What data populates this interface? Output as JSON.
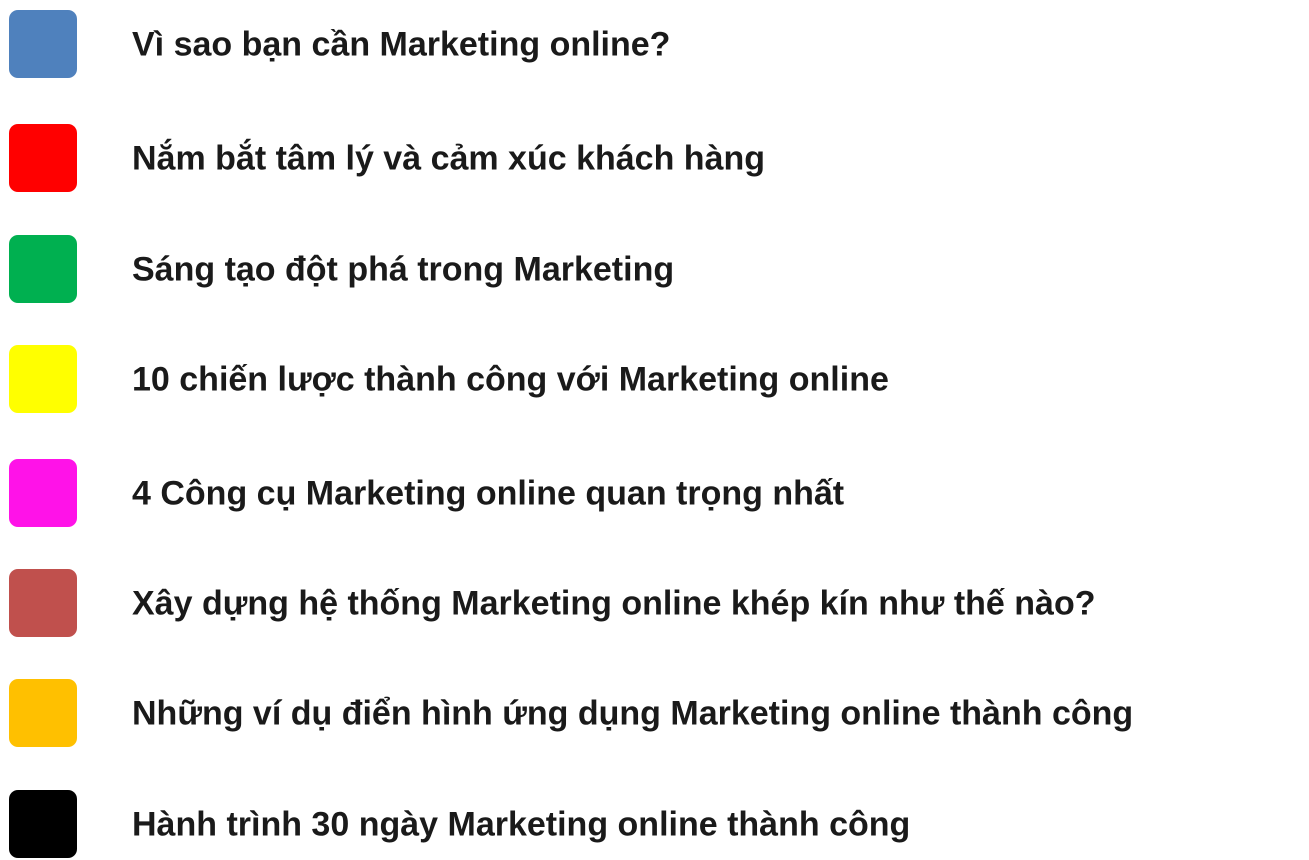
{
  "items": [
    {
      "label": "Vì sao bạn cần Marketing online?",
      "color": "#4F81BD"
    },
    {
      "label": "Nắm bắt tâm lý và cảm xúc khách hàng",
      "color": "#FF0000"
    },
    {
      "label": "Sáng tạo đột phá trong Marketing",
      "color": "#00B050"
    },
    {
      "label": "10 chiến lược thành công với Marketing online",
      "color": "#FFFF00"
    },
    {
      "label": "4 Công cụ Marketing online quan trọng nhất",
      "color": "#FF12E8"
    },
    {
      "label": "Xây dựng hệ thống Marketing online khép kín như thế nào?",
      "color": "#C0504D"
    },
    {
      "label": "Những ví dụ điển hình ứng dụng Marketing online thành công",
      "color": "#FFC000"
    },
    {
      "label": "Hành trình 30 ngày Marketing online thành công",
      "color": "#000000"
    }
  ]
}
